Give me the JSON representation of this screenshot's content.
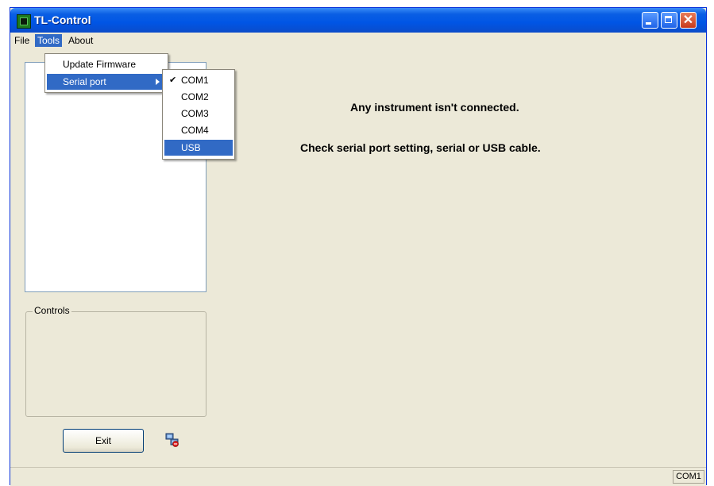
{
  "window": {
    "title": "TL-Control",
    "close_glyph": "✕"
  },
  "menubar": {
    "items": [
      {
        "label": "File"
      },
      {
        "label": "Tools"
      },
      {
        "label": "About"
      }
    ]
  },
  "tools_menu": {
    "items": [
      {
        "label": "Update Firmware"
      },
      {
        "label": "Serial port"
      }
    ]
  },
  "serial_port_submenu": {
    "items": [
      {
        "label": "COM1",
        "checked": true,
        "check_glyph": "✔"
      },
      {
        "label": "COM2"
      },
      {
        "label": "COM3"
      },
      {
        "label": "COM4"
      },
      {
        "label": "USB"
      }
    ]
  },
  "controls": {
    "legend": "Controls"
  },
  "exit_button": {
    "label": "Exit"
  },
  "messages": {
    "line1": "Any instrument isn't connected.",
    "line2": "Check serial port setting, serial or USB cable."
  },
  "statusbar": {
    "port": "COM1"
  },
  "colors": {
    "titlebar": "#0055e5",
    "highlight": "#316ac5",
    "window_bg": "#ece9d8"
  },
  "icons": {
    "app": "app-icon",
    "minimize": "minimize-icon",
    "maximize": "maximize-icon",
    "close": "close-icon",
    "network": "network-icon",
    "submenu_arrow": "arrow-right-icon",
    "check": "check-icon"
  }
}
